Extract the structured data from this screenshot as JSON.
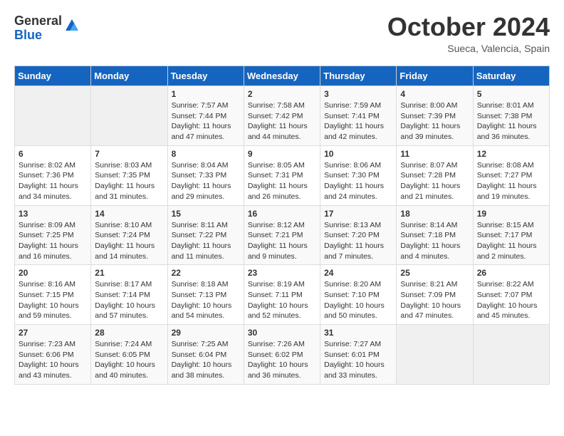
{
  "header": {
    "logo_general": "General",
    "logo_blue": "Blue",
    "month_title": "October 2024",
    "location": "Sueca, Valencia, Spain"
  },
  "days_of_week": [
    "Sunday",
    "Monday",
    "Tuesday",
    "Wednesday",
    "Thursday",
    "Friday",
    "Saturday"
  ],
  "weeks": [
    [
      {
        "day": "",
        "info": ""
      },
      {
        "day": "",
        "info": ""
      },
      {
        "day": "1",
        "info": "Sunrise: 7:57 AM\nSunset: 7:44 PM\nDaylight: 11 hours and 47 minutes."
      },
      {
        "day": "2",
        "info": "Sunrise: 7:58 AM\nSunset: 7:42 PM\nDaylight: 11 hours and 44 minutes."
      },
      {
        "day": "3",
        "info": "Sunrise: 7:59 AM\nSunset: 7:41 PM\nDaylight: 11 hours and 42 minutes."
      },
      {
        "day": "4",
        "info": "Sunrise: 8:00 AM\nSunset: 7:39 PM\nDaylight: 11 hours and 39 minutes."
      },
      {
        "day": "5",
        "info": "Sunrise: 8:01 AM\nSunset: 7:38 PM\nDaylight: 11 hours and 36 minutes."
      }
    ],
    [
      {
        "day": "6",
        "info": "Sunrise: 8:02 AM\nSunset: 7:36 PM\nDaylight: 11 hours and 34 minutes."
      },
      {
        "day": "7",
        "info": "Sunrise: 8:03 AM\nSunset: 7:35 PM\nDaylight: 11 hours and 31 minutes."
      },
      {
        "day": "8",
        "info": "Sunrise: 8:04 AM\nSunset: 7:33 PM\nDaylight: 11 hours and 29 minutes."
      },
      {
        "day": "9",
        "info": "Sunrise: 8:05 AM\nSunset: 7:31 PM\nDaylight: 11 hours and 26 minutes."
      },
      {
        "day": "10",
        "info": "Sunrise: 8:06 AM\nSunset: 7:30 PM\nDaylight: 11 hours and 24 minutes."
      },
      {
        "day": "11",
        "info": "Sunrise: 8:07 AM\nSunset: 7:28 PM\nDaylight: 11 hours and 21 minutes."
      },
      {
        "day": "12",
        "info": "Sunrise: 8:08 AM\nSunset: 7:27 PM\nDaylight: 11 hours and 19 minutes."
      }
    ],
    [
      {
        "day": "13",
        "info": "Sunrise: 8:09 AM\nSunset: 7:25 PM\nDaylight: 11 hours and 16 minutes."
      },
      {
        "day": "14",
        "info": "Sunrise: 8:10 AM\nSunset: 7:24 PM\nDaylight: 11 hours and 14 minutes."
      },
      {
        "day": "15",
        "info": "Sunrise: 8:11 AM\nSunset: 7:22 PM\nDaylight: 11 hours and 11 minutes."
      },
      {
        "day": "16",
        "info": "Sunrise: 8:12 AM\nSunset: 7:21 PM\nDaylight: 11 hours and 9 minutes."
      },
      {
        "day": "17",
        "info": "Sunrise: 8:13 AM\nSunset: 7:20 PM\nDaylight: 11 hours and 7 minutes."
      },
      {
        "day": "18",
        "info": "Sunrise: 8:14 AM\nSunset: 7:18 PM\nDaylight: 11 hours and 4 minutes."
      },
      {
        "day": "19",
        "info": "Sunrise: 8:15 AM\nSunset: 7:17 PM\nDaylight: 11 hours and 2 minutes."
      }
    ],
    [
      {
        "day": "20",
        "info": "Sunrise: 8:16 AM\nSunset: 7:15 PM\nDaylight: 10 hours and 59 minutes."
      },
      {
        "day": "21",
        "info": "Sunrise: 8:17 AM\nSunset: 7:14 PM\nDaylight: 10 hours and 57 minutes."
      },
      {
        "day": "22",
        "info": "Sunrise: 8:18 AM\nSunset: 7:13 PM\nDaylight: 10 hours and 54 minutes."
      },
      {
        "day": "23",
        "info": "Sunrise: 8:19 AM\nSunset: 7:11 PM\nDaylight: 10 hours and 52 minutes."
      },
      {
        "day": "24",
        "info": "Sunrise: 8:20 AM\nSunset: 7:10 PM\nDaylight: 10 hours and 50 minutes."
      },
      {
        "day": "25",
        "info": "Sunrise: 8:21 AM\nSunset: 7:09 PM\nDaylight: 10 hours and 47 minutes."
      },
      {
        "day": "26",
        "info": "Sunrise: 8:22 AM\nSunset: 7:07 PM\nDaylight: 10 hours and 45 minutes."
      }
    ],
    [
      {
        "day": "27",
        "info": "Sunrise: 7:23 AM\nSunset: 6:06 PM\nDaylight: 10 hours and 43 minutes."
      },
      {
        "day": "28",
        "info": "Sunrise: 7:24 AM\nSunset: 6:05 PM\nDaylight: 10 hours and 40 minutes."
      },
      {
        "day": "29",
        "info": "Sunrise: 7:25 AM\nSunset: 6:04 PM\nDaylight: 10 hours and 38 minutes."
      },
      {
        "day": "30",
        "info": "Sunrise: 7:26 AM\nSunset: 6:02 PM\nDaylight: 10 hours and 36 minutes."
      },
      {
        "day": "31",
        "info": "Sunrise: 7:27 AM\nSunset: 6:01 PM\nDaylight: 10 hours and 33 minutes."
      },
      {
        "day": "",
        "info": ""
      },
      {
        "day": "",
        "info": ""
      }
    ]
  ]
}
